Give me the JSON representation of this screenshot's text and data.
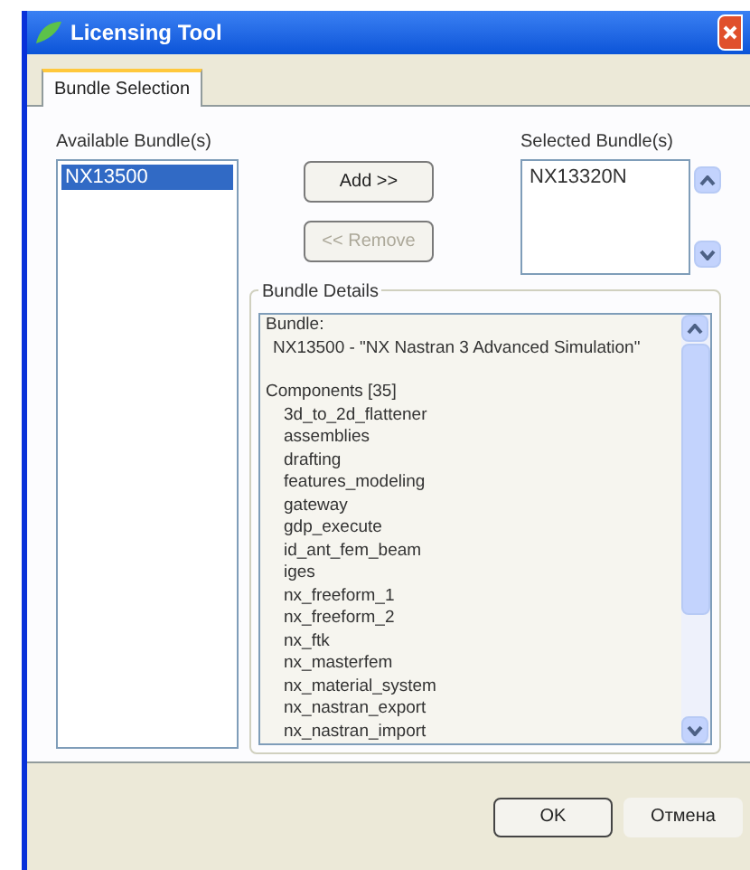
{
  "window": {
    "title": "Licensing Tool"
  },
  "tabs": [
    {
      "label": "Bundle Selection",
      "selected": true
    }
  ],
  "available": {
    "label": "Available Bundle(s)",
    "items": [
      {
        "text": "NX13500",
        "selected": true
      }
    ]
  },
  "buttons": [
    {
      "label": "Add >>",
      "disabled": false
    },
    {
      "label": "<< Remove",
      "disabled": true
    }
  ],
  "selected_bundles": {
    "label": "Selected Bundle(s)",
    "items": [
      {
        "text": "NX13320N",
        "selected": false
      }
    ]
  },
  "details": {
    "label": "Bundle Details",
    "bundle_heading": "Bundle:",
    "bundle_name": "NX13500 - \"NX Nastran 3 Advanced Simulation\"",
    "components_heading": "Components [35]",
    "components": [
      "3d_to_2d_flattener",
      "assemblies",
      "drafting",
      "features_modeling",
      "gateway",
      "gdp_execute",
      "id_ant_fem_beam",
      "iges",
      "nx_freeform_1",
      "nx_freeform_2",
      "nx_ftk",
      "nx_masterfem",
      "nx_material_system",
      "nx_nastran_export",
      "nx_nastran_import"
    ]
  },
  "footer_buttons": [
    "OK",
    "Отмена"
  ]
}
